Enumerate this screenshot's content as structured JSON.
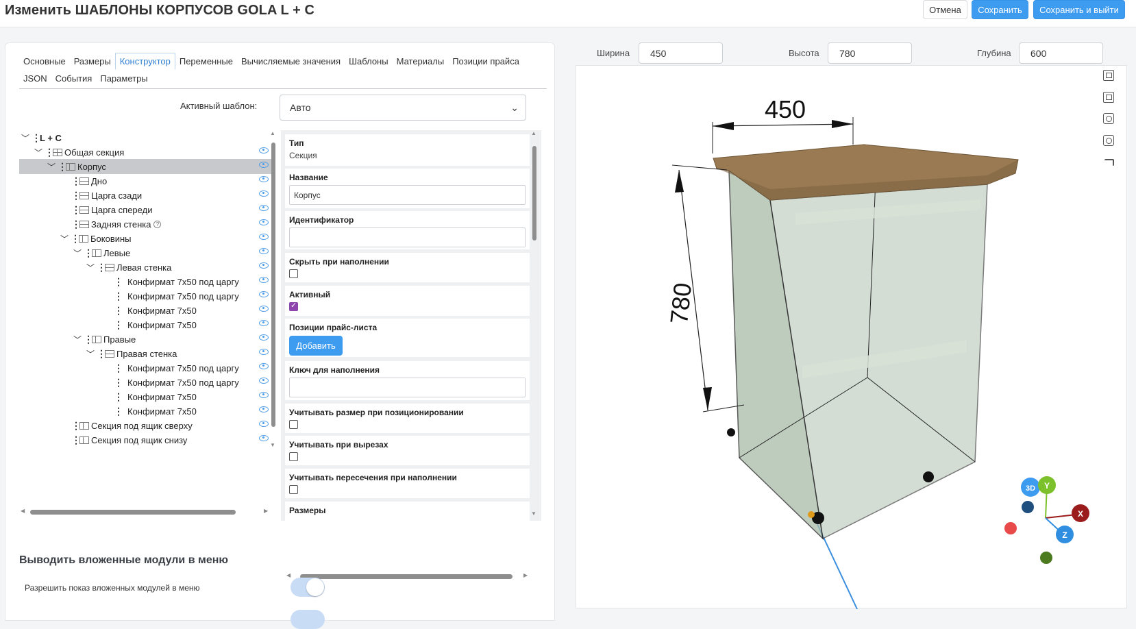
{
  "header": {
    "title": "Изменить ШАБЛОНЫ КОРПУСОВ GOLA L + C",
    "cancel_label": "Отмена",
    "save_label": "Сохранить",
    "save_exit_label": "Сохранить и выйти"
  },
  "tabs": [
    {
      "label": "Основные"
    },
    {
      "label": "Размеры"
    },
    {
      "label": "Конструктор",
      "active": true
    },
    {
      "label": "Переменные"
    },
    {
      "label": "Вычисляемые значения"
    },
    {
      "label": "Шаблоны"
    },
    {
      "label": "Материалы"
    },
    {
      "label": "Позиции прайса"
    },
    {
      "label": "JSON"
    },
    {
      "label": "События"
    },
    {
      "label": "Параметры"
    }
  ],
  "active_template": {
    "label": "Активный шаблон:",
    "value": "Авто"
  },
  "tree": [
    {
      "label": "L + C"
    },
    {
      "label": "Общая секция"
    },
    {
      "label": "Корпус",
      "selected": true
    },
    {
      "label": "Дно"
    },
    {
      "label": "Царга сзади"
    },
    {
      "label": "Царга спереди"
    },
    {
      "label": "Задняя стенка"
    },
    {
      "label": "Боковины"
    },
    {
      "label": "Левые"
    },
    {
      "label": "Левая стенка"
    },
    {
      "label": "Конфирмат 7x50 под царгу"
    },
    {
      "label": "Конфирмат 7x50 под царгу"
    },
    {
      "label": "Конфирмат 7x50"
    },
    {
      "label": "Конфирмат 7x50"
    },
    {
      "label": "Правые"
    },
    {
      "label": "Правая стенка"
    },
    {
      "label": "Конфирмат 7x50 под царгу"
    },
    {
      "label": "Конфирмат 7x50 под царгу"
    },
    {
      "label": "Конфирмат 7x50"
    },
    {
      "label": "Конфирмат 7x50"
    },
    {
      "label": "Секция под ящик сверху"
    },
    {
      "label": "Секция под ящик снизу"
    }
  ],
  "props": {
    "type_label": "Тип",
    "type_value": "Секция",
    "name_label": "Название",
    "name_value": "Корпус",
    "id_label": "Идентификатор",
    "id_value": "",
    "hide_label": "Скрыть при наполнении",
    "hide_checked": false,
    "active_label": "Активный",
    "active_checked": true,
    "price_label": "Позиции прайс-листа",
    "add_label": "Добавить",
    "fill_key_label": "Ключ для наполнения",
    "fill_key_value": "",
    "size_pos_label": "Учитывать размер при позиционировании",
    "size_pos_checked": false,
    "cutout_label": "Учитывать при вырезах",
    "cutout_checked": false,
    "intersect_label": "Учитывать пересечения при наполнении",
    "intersect_checked": false,
    "sizes_label": "Размеры"
  },
  "nested_menu": {
    "title": "Выводить вложенные модули в меню",
    "toggle_label": "Разрешить показ вложенных модулей в меню",
    "enabled": true
  },
  "dimensions": {
    "width_label": "Ширина",
    "width_value": "450",
    "height_label": "Высота",
    "height_value": "780",
    "depth_label": "Глубина",
    "depth_value": "600"
  },
  "viewport": {
    "dim_width_text": "450",
    "dim_height_text": "780",
    "gizmo_3d": "3D",
    "gizmo_y": "Y",
    "gizmo_x": "X",
    "gizmo_z": "Z",
    "colors": {
      "accent": "#3d9bf0",
      "y_axis": "#7cc12b",
      "x_axis": "#9b1c1c",
      "z_axis": "#2f8ee0",
      "countertop": "#9a7a52",
      "glass": "#b9cbbd"
    }
  }
}
